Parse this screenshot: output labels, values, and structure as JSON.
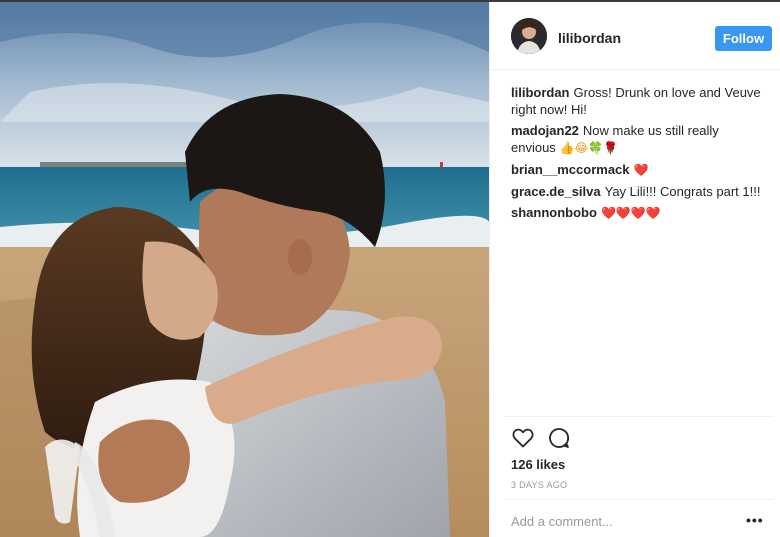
{
  "post": {
    "username": "lilibordan",
    "follow_label": "Follow",
    "comments": [
      {
        "author": "lilibordan",
        "text": "Gross! Drunk on love and Veuve right now! Hi!",
        "emoji": ""
      },
      {
        "author": "madojan22",
        "text": "Now make us still really envious",
        "emoji": "👍😂🍀🌹"
      },
      {
        "author": "brian__mccormack",
        "text": "",
        "emoji": "❤️"
      },
      {
        "author": "grace.de_silva",
        "text": "Yay Lili!!! Congrats part 1!!!",
        "emoji": ""
      },
      {
        "author": "shannonbobo",
        "text": "",
        "emoji": "❤️❤️❤️❤️"
      }
    ],
    "likes": "126 likes",
    "timestamp": "3 DAYS AGO",
    "add_comment_placeholder": "Add a comment...",
    "more_label": "•••"
  },
  "icons": {
    "like": "heart-icon",
    "comment": "comment-bubble-icon",
    "more": "more-options-icon"
  },
  "colors": {
    "accent": "#3897f0",
    "text": "#262626",
    "muted": "#999999",
    "heart": "#d61b2a"
  }
}
